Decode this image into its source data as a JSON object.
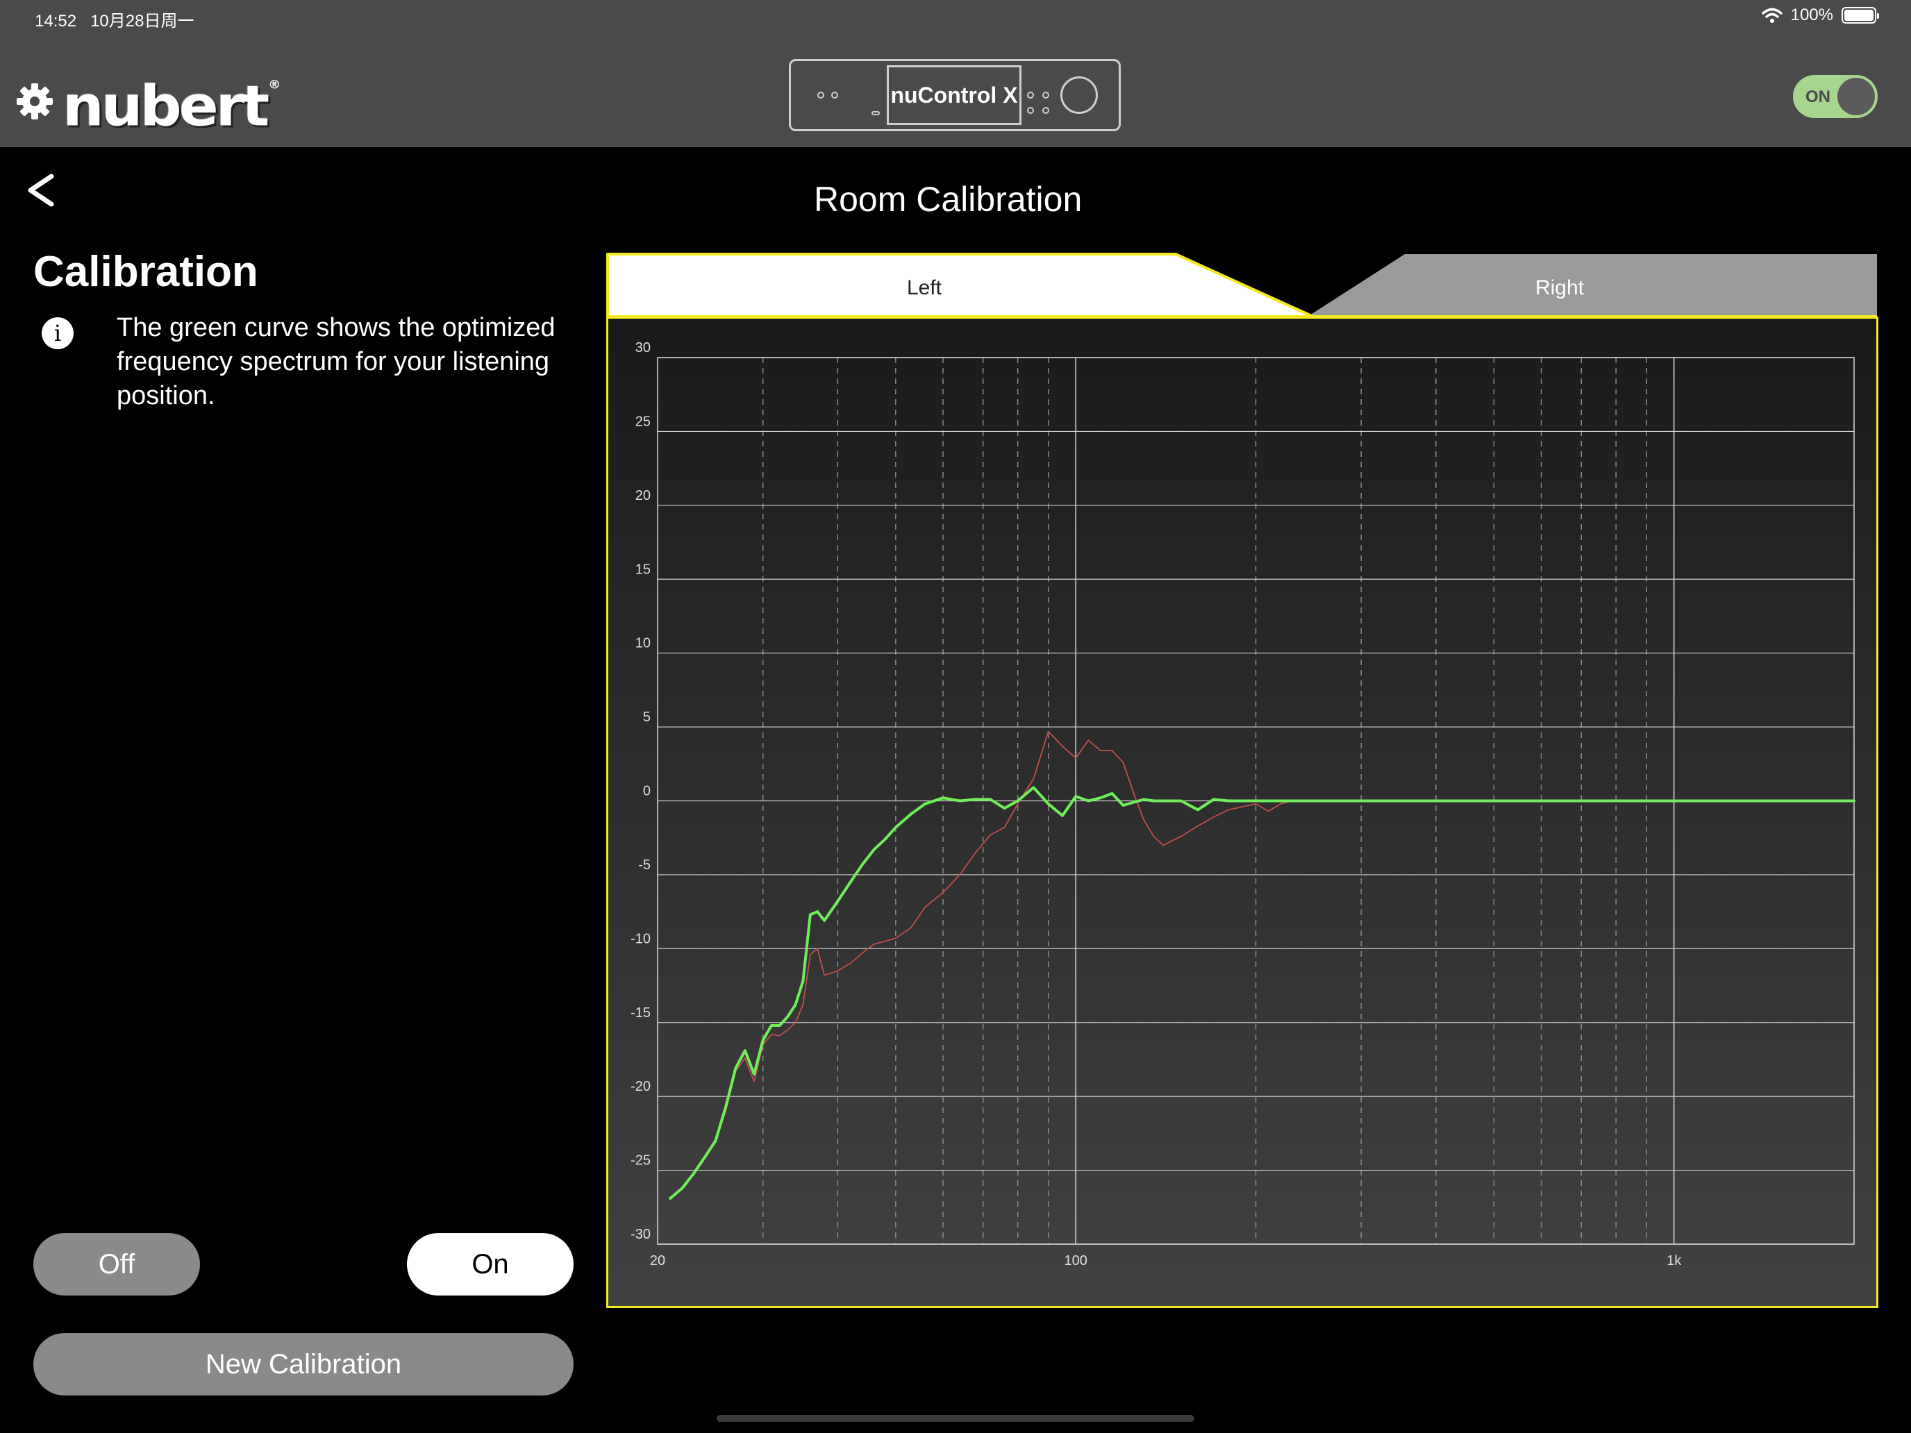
{
  "status_bar": {
    "time": "14:52",
    "date": "10月28日周一",
    "battery": "100%"
  },
  "header": {
    "logo": "nubert",
    "logo_mark": "®",
    "device_name": "nuControl X",
    "power_label": "ON",
    "power_on": true
  },
  "page": {
    "title": "Room Calibration"
  },
  "calibration": {
    "heading": "Calibration",
    "info": "The green curve shows the optimized frequency spectrum for your listening position.",
    "off_label": "Off",
    "on_label": "On",
    "selected": "On",
    "new_label": "New Calibration"
  },
  "tabs": {
    "left": "Left",
    "right": "Right",
    "active": "Left"
  },
  "colors": {
    "accent": "#f5ea20",
    "optimized": "#6fee5a",
    "measured": "#c0504d",
    "toggle": "#a6d68e"
  },
  "icons": {
    "settings": "gear-icon",
    "back": "chevron-left-icon",
    "info": "info-icon",
    "wifi": "wifi-icon",
    "battery": "battery-icon"
  },
  "chart_data": {
    "type": "line",
    "x_scale": "log",
    "xlim": [
      20,
      2000
    ],
    "ylim": [
      -30,
      30
    ],
    "x_ticks": [
      {
        "value": 20,
        "label": "20"
      },
      {
        "value": 100,
        "label": "100"
      },
      {
        "value": 1000,
        "label": "1k"
      }
    ],
    "y_ticks": [
      30,
      25,
      20,
      15,
      10,
      5,
      0,
      -5,
      -10,
      -15,
      -20,
      -25,
      -30
    ],
    "grid": true,
    "series": [
      {
        "color": "#c0504d",
        "x": [
          21,
          22,
          23,
          24,
          25,
          26,
          27,
          28,
          29,
          30,
          31,
          32,
          33,
          34,
          35,
          36,
          37,
          38,
          40,
          42,
          44,
          46,
          48,
          50,
          53,
          56,
          60,
          64,
          68,
          72,
          76,
          80,
          85,
          90,
          95,
          100,
          105,
          110,
          115,
          120,
          125,
          130,
          135,
          140,
          150,
          160,
          170,
          180,
          190,
          200,
          210,
          220,
          230,
          240,
          250,
          260,
          270,
          280,
          290,
          300,
          350,
          400,
          500,
          600,
          800,
          1000,
          1200,
          1500,
          2000
        ],
        "y": [
          -26.9,
          -26.2,
          -25.2,
          -24.1,
          -23,
          -21,
          -18.3,
          -17.4,
          -19,
          -16.5,
          -15.8,
          -15.9,
          -15.5,
          -15,
          -13.8,
          -10.4,
          -10,
          -11.8,
          -11.5,
          -11,
          -10.3,
          -9.7,
          -9.5,
          -9.3,
          -8.6,
          -7.2,
          -6.2,
          -5,
          -3.5,
          -2.3,
          -1.8,
          -0.2,
          1.5,
          4.7,
          3.7,
          2.9,
          4.1,
          3.4,
          3.4,
          2.6,
          0.5,
          -1.3,
          -2.4,
          -3,
          -2.4,
          -1.7,
          -1.1,
          -0.6,
          -0.4,
          -0.2,
          -0.7,
          -0.2,
          0,
          0,
          0,
          0,
          0,
          0,
          0,
          0,
          0,
          0,
          0,
          0,
          0,
          0,
          0,
          0,
          0
        ]
      },
      {
        "color": "#6fee5a",
        "x": [
          21,
          22,
          23,
          24,
          25,
          26,
          27,
          28,
          29,
          30,
          31,
          32,
          33,
          34,
          35,
          36,
          37,
          38,
          40,
          42,
          44,
          46,
          48,
          50,
          53,
          56,
          60,
          64,
          68,
          72,
          76,
          80,
          85,
          90,
          95,
          100,
          105,
          110,
          115,
          120,
          125,
          130,
          135,
          140,
          150,
          160,
          170,
          180,
          190,
          200,
          210,
          220,
          230,
          240,
          250,
          260,
          270,
          280,
          290,
          300,
          350,
          400,
          500,
          600,
          800,
          1000,
          1200,
          1500,
          2000
        ],
        "y": [
          -26.9,
          -26.2,
          -25.2,
          -24.1,
          -23,
          -20.7,
          -18.1,
          -16.9,
          -18.5,
          -16.2,
          -15.2,
          -15.2,
          -14.6,
          -13.8,
          -12.2,
          -7.7,
          -7.5,
          -8.1,
          -6.8,
          -5.5,
          -4.3,
          -3.3,
          -2.6,
          -1.8,
          -0.9,
          -0.2,
          0.2,
          0,
          0.1,
          0.1,
          -0.5,
          0,
          0.9,
          -0.2,
          -1,
          0.3,
          0,
          0.2,
          0.5,
          -0.3,
          -0.1,
          0.1,
          0,
          0,
          0,
          -0.6,
          0.1,
          0,
          0,
          0,
          0,
          0,
          0,
          0,
          0,
          0,
          0,
          0,
          0,
          0,
          0,
          0,
          0,
          0,
          0,
          0,
          0,
          0,
          0
        ]
      }
    ]
  }
}
